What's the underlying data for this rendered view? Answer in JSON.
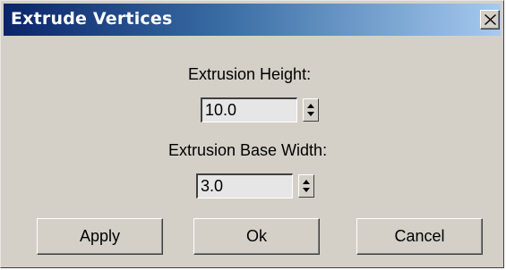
{
  "window": {
    "title": "Extrude Vertices"
  },
  "fields": {
    "height_label": "Extrusion Height:",
    "height_value": "10.0",
    "base_width_label": "Extrusion Base Width:",
    "base_width_value": "3.0"
  },
  "buttons": {
    "apply": "Apply",
    "ok": "Ok",
    "cancel": "Cancel"
  },
  "icons": {
    "close": "close-icon",
    "spinner": "spinner-arrows-icon"
  }
}
